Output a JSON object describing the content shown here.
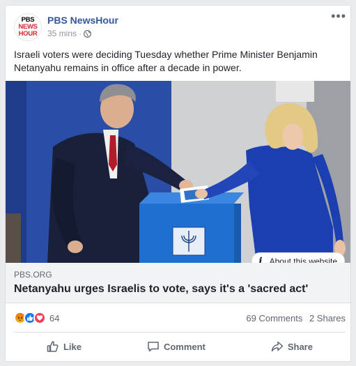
{
  "post": {
    "page_name": "PBS NewsHour",
    "avatar_lines": [
      "PBS",
      "NEWS",
      "HOUR"
    ],
    "time": "35 mins",
    "separator": "·",
    "privacy_icon": "globe-icon",
    "more_icon": "•••",
    "text": "Israeli voters were deciding Tuesday whether Prime Minister Benjamin Netanyahu remains in office after a decade in power."
  },
  "link": {
    "about_label": "About this website",
    "domain": "PBS.ORG",
    "title": "Netanyahu urges Israelis to vote, says it's a 'sacred act'"
  },
  "stats": {
    "reaction_icons": [
      "angry-icon",
      "like-icon",
      "love-icon"
    ],
    "reaction_count": "64",
    "comments": "69 Comments",
    "shares": "2 Shares"
  },
  "actions": {
    "like": "Like",
    "comment": "Comment",
    "share": "Share"
  },
  "colors": {
    "page_name": "#365899",
    "link_bg": "#f2f3f5",
    "brand_red": "#d8282f"
  }
}
